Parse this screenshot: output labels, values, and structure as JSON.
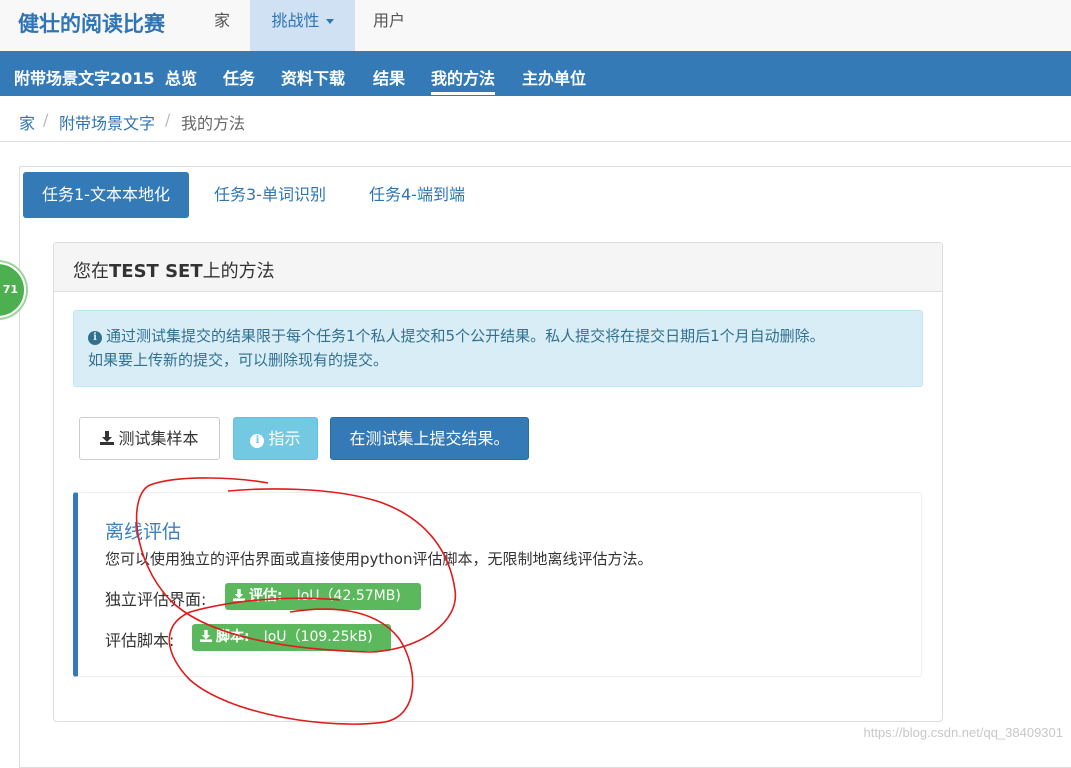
{
  "topbar": {
    "brand": "健壮的阅读比赛",
    "items": [
      "家",
      "挑战性",
      "用户"
    ]
  },
  "subnav": {
    "items": [
      "附带场景文字2015",
      "总览",
      "任务",
      "资料下载",
      "结果",
      "我的方法",
      "主办单位"
    ],
    "active": "我的方法"
  },
  "breadcrumb": {
    "home": "家",
    "section": "附带场景文字",
    "current": "我的方法",
    "separator": "/"
  },
  "tabs": [
    "任务1-文本本地化",
    "任务3-单词识别",
    "任务4-端到端"
  ],
  "badge": "71",
  "panel": {
    "title_prefix": "您在",
    "title_bold": "TEST SET",
    "title_suffix": "上的方法"
  },
  "alert": {
    "line1": "通过测试集提交的结果限于每个任务1个私人提交和5个公开结果。私人提交将在提交日期后1个月自动删除。",
    "line2": "如果要上传新的提交，可以删除现有的提交。"
  },
  "buttons": {
    "samples": "测试集样本",
    "instructions": "指示",
    "submit": "在测试集上提交结果。"
  },
  "offline": {
    "title": "离线评估",
    "description": "您可以使用独立的评估界面或直接使用python评估脚本，无限制地离线评估方法。",
    "interface_label": "独立评估界面:",
    "interface_tag": "评估:",
    "interface_file": "IoU（42.57MB)",
    "script_label": "评估脚本:",
    "script_tag": "脚本:",
    "script_file": "IoU（109.25kB)"
  },
  "watermark": "https://blog.csdn.net/qq_38409301",
  "colors": {
    "primary": "#337ab7",
    "brand": "#2f74b5",
    "success": "#5cb85c",
    "info": "#5bc0de",
    "alert_bg": "#d9edf7",
    "annotation": "#e01b1b"
  }
}
